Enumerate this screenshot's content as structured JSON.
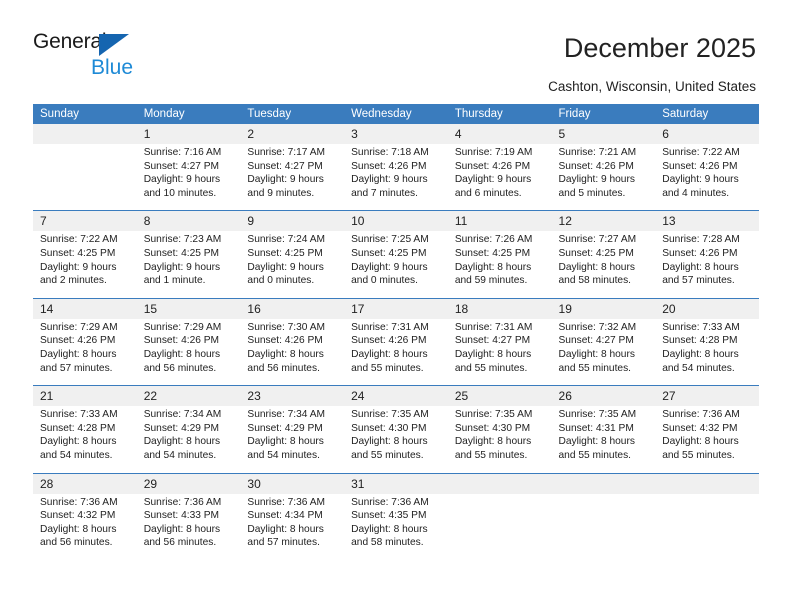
{
  "brand": {
    "name_top": "General",
    "name_bottom": "Blue",
    "triangle_color": "#1565b0",
    "blue_color": "#1e8ad6"
  },
  "header": {
    "title": "December 2025",
    "location": "Cashton, Wisconsin, United States"
  },
  "theme": {
    "header_bg": "#3a7cbe",
    "header_text": "#ffffff",
    "daynum_bg": "#f0f0f0",
    "separator": "#3a7cbe",
    "body_text": "#222222"
  },
  "weekday_headers": [
    "Sunday",
    "Monday",
    "Tuesday",
    "Wednesday",
    "Thursday",
    "Friday",
    "Saturday"
  ],
  "weeks": [
    {
      "days": [
        {
          "num": "",
          "sunrise": "",
          "sunset": "",
          "daylight_1": "",
          "daylight_2": ""
        },
        {
          "num": "1",
          "sunrise": "Sunrise: 7:16 AM",
          "sunset": "Sunset: 4:27 PM",
          "daylight_1": "Daylight: 9 hours",
          "daylight_2": "and 10 minutes."
        },
        {
          "num": "2",
          "sunrise": "Sunrise: 7:17 AM",
          "sunset": "Sunset: 4:27 PM",
          "daylight_1": "Daylight: 9 hours",
          "daylight_2": "and 9 minutes."
        },
        {
          "num": "3",
          "sunrise": "Sunrise: 7:18 AM",
          "sunset": "Sunset: 4:26 PM",
          "daylight_1": "Daylight: 9 hours",
          "daylight_2": "and 7 minutes."
        },
        {
          "num": "4",
          "sunrise": "Sunrise: 7:19 AM",
          "sunset": "Sunset: 4:26 PM",
          "daylight_1": "Daylight: 9 hours",
          "daylight_2": "and 6 minutes."
        },
        {
          "num": "5",
          "sunrise": "Sunrise: 7:21 AM",
          "sunset": "Sunset: 4:26 PM",
          "daylight_1": "Daylight: 9 hours",
          "daylight_2": "and 5 minutes."
        },
        {
          "num": "6",
          "sunrise": "Sunrise: 7:22 AM",
          "sunset": "Sunset: 4:26 PM",
          "daylight_1": "Daylight: 9 hours",
          "daylight_2": "and 4 minutes."
        }
      ]
    },
    {
      "days": [
        {
          "num": "7",
          "sunrise": "Sunrise: 7:22 AM",
          "sunset": "Sunset: 4:25 PM",
          "daylight_1": "Daylight: 9 hours",
          "daylight_2": "and 2 minutes."
        },
        {
          "num": "8",
          "sunrise": "Sunrise: 7:23 AM",
          "sunset": "Sunset: 4:25 PM",
          "daylight_1": "Daylight: 9 hours",
          "daylight_2": "and 1 minute."
        },
        {
          "num": "9",
          "sunrise": "Sunrise: 7:24 AM",
          "sunset": "Sunset: 4:25 PM",
          "daylight_1": "Daylight: 9 hours",
          "daylight_2": "and 0 minutes."
        },
        {
          "num": "10",
          "sunrise": "Sunrise: 7:25 AM",
          "sunset": "Sunset: 4:25 PM",
          "daylight_1": "Daylight: 9 hours",
          "daylight_2": "and 0 minutes."
        },
        {
          "num": "11",
          "sunrise": "Sunrise: 7:26 AM",
          "sunset": "Sunset: 4:25 PM",
          "daylight_1": "Daylight: 8 hours",
          "daylight_2": "and 59 minutes."
        },
        {
          "num": "12",
          "sunrise": "Sunrise: 7:27 AM",
          "sunset": "Sunset: 4:25 PM",
          "daylight_1": "Daylight: 8 hours",
          "daylight_2": "and 58 minutes."
        },
        {
          "num": "13",
          "sunrise": "Sunrise: 7:28 AM",
          "sunset": "Sunset: 4:26 PM",
          "daylight_1": "Daylight: 8 hours",
          "daylight_2": "and 57 minutes."
        }
      ]
    },
    {
      "days": [
        {
          "num": "14",
          "sunrise": "Sunrise: 7:29 AM",
          "sunset": "Sunset: 4:26 PM",
          "daylight_1": "Daylight: 8 hours",
          "daylight_2": "and 57 minutes."
        },
        {
          "num": "15",
          "sunrise": "Sunrise: 7:29 AM",
          "sunset": "Sunset: 4:26 PM",
          "daylight_1": "Daylight: 8 hours",
          "daylight_2": "and 56 minutes."
        },
        {
          "num": "16",
          "sunrise": "Sunrise: 7:30 AM",
          "sunset": "Sunset: 4:26 PM",
          "daylight_1": "Daylight: 8 hours",
          "daylight_2": "and 56 minutes."
        },
        {
          "num": "17",
          "sunrise": "Sunrise: 7:31 AM",
          "sunset": "Sunset: 4:26 PM",
          "daylight_1": "Daylight: 8 hours",
          "daylight_2": "and 55 minutes."
        },
        {
          "num": "18",
          "sunrise": "Sunrise: 7:31 AM",
          "sunset": "Sunset: 4:27 PM",
          "daylight_1": "Daylight: 8 hours",
          "daylight_2": "and 55 minutes."
        },
        {
          "num": "19",
          "sunrise": "Sunrise: 7:32 AM",
          "sunset": "Sunset: 4:27 PM",
          "daylight_1": "Daylight: 8 hours",
          "daylight_2": "and 55 minutes."
        },
        {
          "num": "20",
          "sunrise": "Sunrise: 7:33 AM",
          "sunset": "Sunset: 4:28 PM",
          "daylight_1": "Daylight: 8 hours",
          "daylight_2": "and 54 minutes."
        }
      ]
    },
    {
      "days": [
        {
          "num": "21",
          "sunrise": "Sunrise: 7:33 AM",
          "sunset": "Sunset: 4:28 PM",
          "daylight_1": "Daylight: 8 hours",
          "daylight_2": "and 54 minutes."
        },
        {
          "num": "22",
          "sunrise": "Sunrise: 7:34 AM",
          "sunset": "Sunset: 4:29 PM",
          "daylight_1": "Daylight: 8 hours",
          "daylight_2": "and 54 minutes."
        },
        {
          "num": "23",
          "sunrise": "Sunrise: 7:34 AM",
          "sunset": "Sunset: 4:29 PM",
          "daylight_1": "Daylight: 8 hours",
          "daylight_2": "and 54 minutes."
        },
        {
          "num": "24",
          "sunrise": "Sunrise: 7:35 AM",
          "sunset": "Sunset: 4:30 PM",
          "daylight_1": "Daylight: 8 hours",
          "daylight_2": "and 55 minutes."
        },
        {
          "num": "25",
          "sunrise": "Sunrise: 7:35 AM",
          "sunset": "Sunset: 4:30 PM",
          "daylight_1": "Daylight: 8 hours",
          "daylight_2": "and 55 minutes."
        },
        {
          "num": "26",
          "sunrise": "Sunrise: 7:35 AM",
          "sunset": "Sunset: 4:31 PM",
          "daylight_1": "Daylight: 8 hours",
          "daylight_2": "and 55 minutes."
        },
        {
          "num": "27",
          "sunrise": "Sunrise: 7:36 AM",
          "sunset": "Sunset: 4:32 PM",
          "daylight_1": "Daylight: 8 hours",
          "daylight_2": "and 55 minutes."
        }
      ]
    },
    {
      "days": [
        {
          "num": "28",
          "sunrise": "Sunrise: 7:36 AM",
          "sunset": "Sunset: 4:32 PM",
          "daylight_1": "Daylight: 8 hours",
          "daylight_2": "and 56 minutes."
        },
        {
          "num": "29",
          "sunrise": "Sunrise: 7:36 AM",
          "sunset": "Sunset: 4:33 PM",
          "daylight_1": "Daylight: 8 hours",
          "daylight_2": "and 56 minutes."
        },
        {
          "num": "30",
          "sunrise": "Sunrise: 7:36 AM",
          "sunset": "Sunset: 4:34 PM",
          "daylight_1": "Daylight: 8 hours",
          "daylight_2": "and 57 minutes."
        },
        {
          "num": "31",
          "sunrise": "Sunrise: 7:36 AM",
          "sunset": "Sunset: 4:35 PM",
          "daylight_1": "Daylight: 8 hours",
          "daylight_2": "and 58 minutes."
        },
        {
          "num": "",
          "sunrise": "",
          "sunset": "",
          "daylight_1": "",
          "daylight_2": ""
        },
        {
          "num": "",
          "sunrise": "",
          "sunset": "",
          "daylight_1": "",
          "daylight_2": ""
        },
        {
          "num": "",
          "sunrise": "",
          "sunset": "",
          "daylight_1": "",
          "daylight_2": ""
        }
      ]
    }
  ]
}
